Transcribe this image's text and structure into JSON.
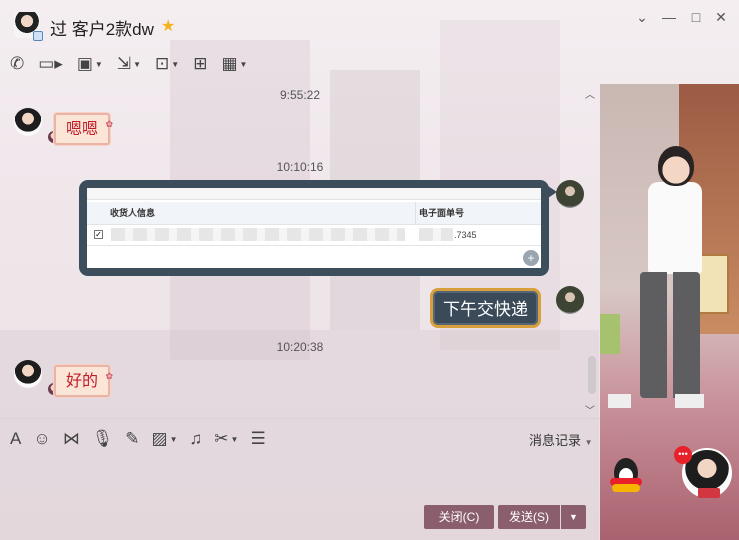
{
  "window": {
    "contact_name": "过 客户2款dw",
    "vip_icon": "star-icon",
    "controls": [
      "minimize-icon",
      "restore-icon",
      "close-icon"
    ]
  },
  "toolbar": {
    "items": [
      "phone-icon",
      "video-icon",
      "screen-share-icon",
      "file-transfer-icon",
      "remote-desktop-icon",
      "whiteboard-icon",
      "apps-grid-icon"
    ]
  },
  "chat": {
    "messages": [
      {
        "type": "time",
        "text": "9:55:22"
      },
      {
        "type": "incoming",
        "text": "嗯嗯"
      },
      {
        "type": "time",
        "text": "10:10:16"
      },
      {
        "type": "outgoing_image",
        "table_headers": [
          "收货人信息",
          "电子面单号"
        ],
        "row_number": ".7345"
      },
      {
        "type": "outgoing",
        "text": "下午交快递"
      },
      {
        "type": "time",
        "text": "10:20:38"
      },
      {
        "type": "incoming",
        "text": "好的"
      }
    ]
  },
  "input_toolbar": {
    "items": [
      "font-icon",
      "emoji-icon",
      "gif-icon",
      "voice-icon",
      "pen-icon",
      "image-icon",
      "music-icon",
      "screenshot-icon",
      "clipboard-icon"
    ],
    "history_label": "消息记录"
  },
  "buttons": {
    "close_label": "关闭(C)",
    "send_label": "发送(S)"
  },
  "colors": {
    "button_bg": "#8a5e6d",
    "incoming_text": "#c21c2b",
    "outgoing_border": "#d8a03c"
  }
}
